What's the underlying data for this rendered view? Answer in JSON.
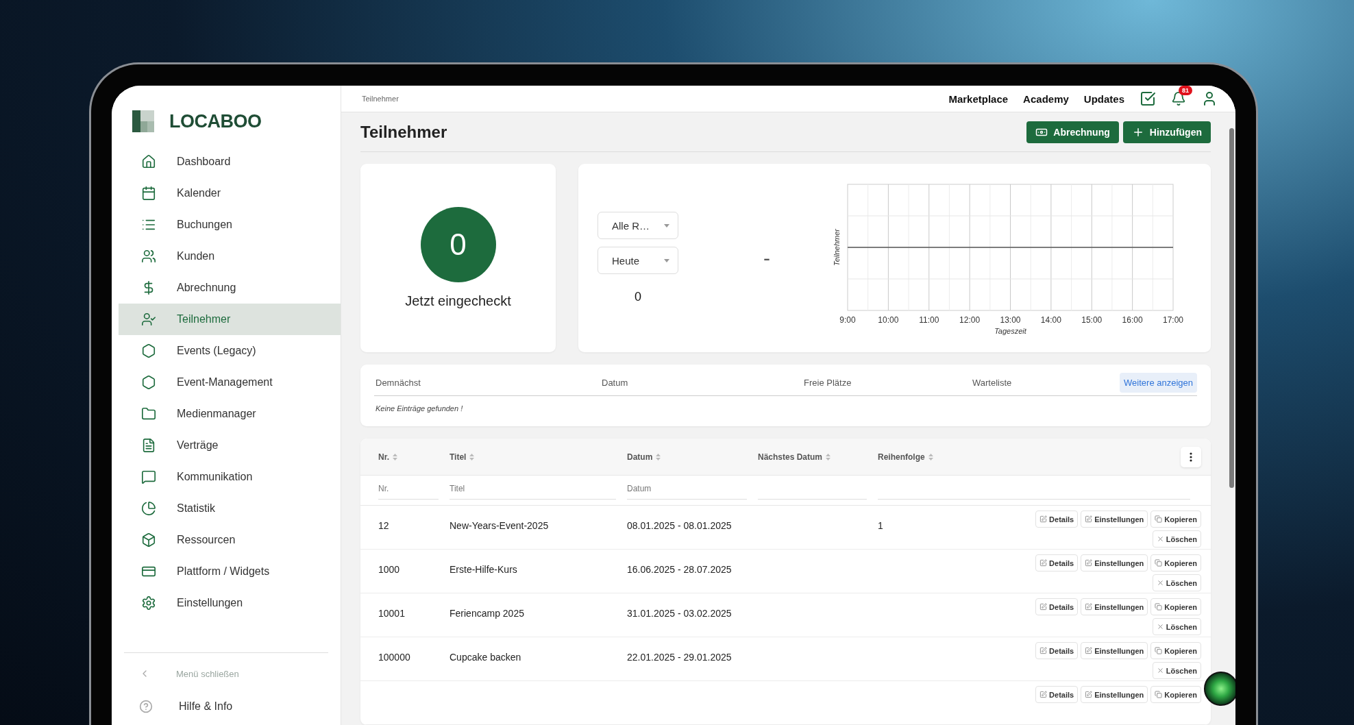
{
  "sidebar": {
    "logo": "LOCABOO",
    "items": [
      {
        "label": "Dashboard",
        "selected": false
      },
      {
        "label": "Kalender",
        "selected": false
      },
      {
        "label": "Buchungen",
        "selected": false
      },
      {
        "label": "Kunden",
        "selected": false
      },
      {
        "label": "Abrechnung",
        "selected": false
      },
      {
        "label": "Teilnehmer",
        "selected": true
      },
      {
        "label": "Events (Legacy)",
        "selected": false
      },
      {
        "label": "Event-Management",
        "selected": false
      },
      {
        "label": "Medienmanager",
        "selected": false
      },
      {
        "label": "Verträge",
        "selected": false
      },
      {
        "label": "Kommunikation",
        "selected": false
      },
      {
        "label": "Statistik",
        "selected": false
      },
      {
        "label": "Ressourcen",
        "selected": false
      },
      {
        "label": "Plattform / Widgets",
        "selected": false
      },
      {
        "label": "Einstellungen",
        "selected": false
      }
    ],
    "collapse": "Menü schließen",
    "help": "Hilfe & Info"
  },
  "topbar": {
    "breadcrumb": "Teilnehmer",
    "links": [
      "Marketplace",
      "Academy",
      "Updates"
    ],
    "notification_count": "81"
  },
  "page": {
    "title": "Teilnehmer",
    "buttons": [
      "Abrechnung",
      "Hinzufügen"
    ]
  },
  "checked_in": {
    "count": "0",
    "label": "Jetzt eingecheckt"
  },
  "stats": {
    "filters": [
      "Alle R…",
      "Heute"
    ],
    "total": "0",
    "range": "-",
    "chart": {
      "ylabel": "Teilnehmer",
      "xlabel": "Tageszeit",
      "x_labels": [
        "9:00",
        "10:00",
        "11:00",
        "12:00",
        "13:00",
        "14:00",
        "15:00",
        "16:00",
        "17:00"
      ]
    }
  },
  "upcoming": {
    "columns": [
      "Demnächst",
      "Datum",
      "Freie Plätze",
      "Warteliste"
    ],
    "more_button": "Weitere anzeigen",
    "empty": "Keine Einträge gefunden !"
  },
  "table": {
    "columns": [
      "Nr.",
      "Titel",
      "Datum",
      "Nächstes Datum",
      "Reihenfolge"
    ],
    "filter_placeholders": [
      "Nr.",
      "Titel",
      "Datum"
    ],
    "rows": [
      {
        "nr": "12",
        "title": "New-Years-Event-2025",
        "date": "08.01.2025 - 08.01.2025",
        "order": "1",
        "actions": [
          {
            "label": "Details",
            "kind": "edit"
          },
          {
            "label": "Einstellungen",
            "kind": "edit"
          },
          {
            "label": "Kopieren",
            "kind": "copy"
          },
          {
            "label": "Löschen",
            "kind": "delete"
          }
        ]
      },
      {
        "nr": "1000",
        "title": "Erste-Hilfe-Kurs",
        "date": "16.06.2025 - 28.07.2025",
        "actions": [
          {
            "label": "Details",
            "kind": "edit"
          },
          {
            "label": "Einstellungen",
            "kind": "edit"
          },
          {
            "label": "Kopieren",
            "kind": "copy"
          },
          {
            "label": "Löschen",
            "kind": "delete"
          }
        ]
      },
      {
        "nr": "10001",
        "title": "Feriencamp 2025",
        "date": "31.01.2025 - 03.02.2025",
        "actions": [
          {
            "label": "Details",
            "kind": "edit"
          },
          {
            "label": "Einstellungen",
            "kind": "edit"
          },
          {
            "label": "Kopieren",
            "kind": "copy"
          },
          {
            "label": "Löschen",
            "kind": "delete"
          }
        ]
      },
      {
        "nr": "100000",
        "title": "Cupcake backen",
        "date": "22.01.2025 - 29.01.2025",
        "actions": [
          {
            "label": "Details",
            "kind": "edit"
          },
          {
            "label": "Einstellungen",
            "kind": "edit"
          },
          {
            "label": "Kopieren",
            "kind": "copy"
          },
          {
            "label": "Löschen",
            "kind": "delete"
          }
        ]
      },
      {
        "actions": [
          {
            "label": "Details",
            "kind": "edit"
          },
          {
            "label": "Einstellungen",
            "kind": "edit"
          },
          {
            "label": "Kopieren",
            "kind": "copy"
          }
        ]
      }
    ]
  }
}
